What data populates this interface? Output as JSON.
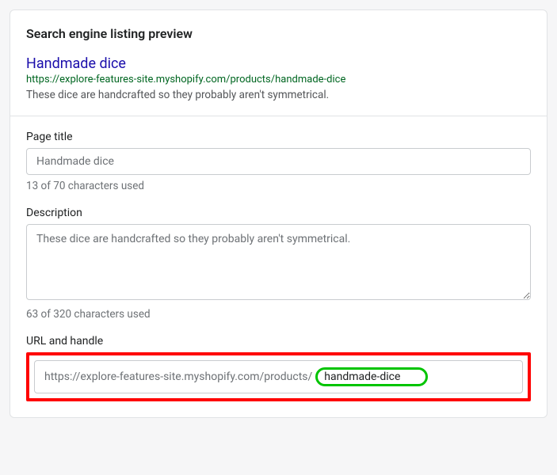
{
  "section": {
    "title": "Search engine listing preview"
  },
  "preview": {
    "title": "Handmade dice",
    "url": "https://explore-features-site.myshopify.com/products/handmade-dice",
    "description": "These dice are handcrafted so they probably aren't symmetrical."
  },
  "fields": {
    "page_title": {
      "label": "Page title",
      "value": "Handmade dice",
      "helper": "13 of 70 characters used"
    },
    "description": {
      "label": "Description",
      "value": "These dice are handcrafted so they probably aren't symmetrical.",
      "helper": "63 of 320 characters used"
    },
    "url": {
      "label": "URL and handle",
      "prefix": "https://explore-features-site.myshopify.com/products/",
      "handle": "handmade-dice"
    }
  }
}
